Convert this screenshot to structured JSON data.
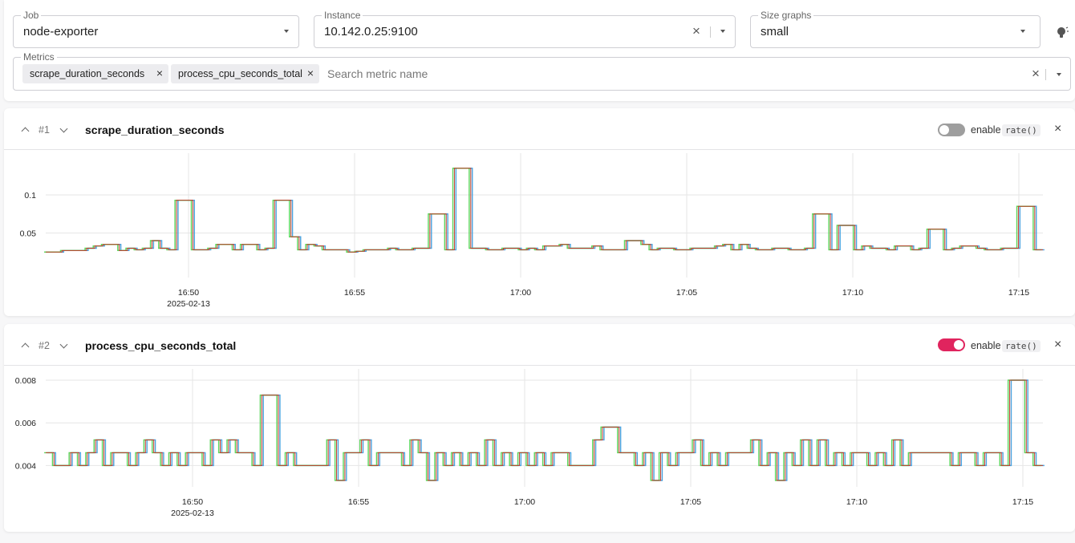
{
  "filters": {
    "job": {
      "label": "Job",
      "value": "node-exporter"
    },
    "instance": {
      "label": "Instance",
      "value": "10.142.0.25:9100"
    },
    "size_graphs": {
      "label": "Size graphs",
      "value": "small"
    },
    "metrics": {
      "label": "Metrics",
      "selected": [
        "scrape_duration_seconds",
        "process_cpu_seconds_total"
      ],
      "placeholder": "Search metric name"
    }
  },
  "panels": [
    {
      "index": "#1",
      "title": "scrape_duration_seconds",
      "rate_enabled": false,
      "enable_label": "enable",
      "rate_code": "rate()",
      "y_ticks": [
        "0.1",
        "0.05"
      ],
      "x_ticks": [
        "16:50",
        "16:55",
        "17:00",
        "17:05",
        "17:10",
        "17:15"
      ],
      "x_date": "2025-02-13"
    },
    {
      "index": "#2",
      "title": "process_cpu_seconds_total",
      "rate_enabled": true,
      "enable_label": "enable",
      "rate_code": "rate()",
      "y_ticks": [
        "0.008",
        "0.006",
        "0.004"
      ],
      "x_ticks": [
        "16:50",
        "16:55",
        "17:00",
        "17:05",
        "17:10",
        "17:15"
      ],
      "x_date": "2025-02-13"
    }
  ],
  "colors": {
    "series": [
      "#4aa3df",
      "#c0392b",
      "#5cd65c"
    ],
    "toggle_on": "#e0245e",
    "toggle_off": "#9e9e9e"
  },
  "chart_data": [
    {
      "type": "line",
      "title": "scrape_duration_seconds",
      "x_range": [
        "16:46",
        "17:16"
      ],
      "ylim": [
        0,
        0.14
      ],
      "series_count": 3,
      "values": [
        0.025,
        0.025,
        0.027,
        0.027,
        0.027,
        0.03,
        0.033,
        0.035,
        0.035,
        0.027,
        0.03,
        0.028,
        0.03,
        0.04,
        0.03,
        0.028,
        0.093,
        0.093,
        0.028,
        0.028,
        0.03,
        0.035,
        0.035,
        0.028,
        0.035,
        0.035,
        0.028,
        0.03,
        0.093,
        0.093,
        0.045,
        0.028,
        0.035,
        0.033,
        0.028,
        0.028,
        0.028,
        0.025,
        0.026,
        0.028,
        0.028,
        0.028,
        0.03,
        0.028,
        0.028,
        0.03,
        0.03,
        0.075,
        0.075,
        0.028,
        0.135,
        0.135,
        0.03,
        0.03,
        0.028,
        0.028,
        0.03,
        0.03,
        0.028,
        0.03,
        0.028,
        0.033,
        0.033,
        0.035,
        0.03,
        0.03,
        0.03,
        0.033,
        0.028,
        0.028,
        0.028,
        0.04,
        0.04,
        0.035,
        0.028,
        0.03,
        0.03,
        0.028,
        0.028,
        0.03,
        0.03,
        0.03,
        0.033,
        0.035,
        0.028,
        0.035,
        0.03,
        0.028,
        0.028,
        0.03,
        0.03,
        0.028,
        0.028,
        0.03,
        0.075,
        0.075,
        0.028,
        0.06,
        0.06,
        0.028,
        0.033,
        0.03,
        0.03,
        0.028,
        0.033,
        0.033,
        0.028,
        0.03,
        0.055,
        0.055,
        0.028,
        0.03,
        0.033,
        0.033,
        0.03,
        0.028,
        0.028,
        0.03,
        0.03,
        0.085,
        0.085,
        0.028,
        0.028
      ]
    },
    {
      "type": "line",
      "title": "process_cpu_seconds_total",
      "x_range": [
        "16:46",
        "17:16"
      ],
      "ylim": [
        0.0033,
        0.008
      ],
      "series_count": 3,
      "values": [
        0.0046,
        0.004,
        0.004,
        0.0046,
        0.004,
        0.0046,
        0.0052,
        0.004,
        0.0046,
        0.0046,
        0.004,
        0.0046,
        0.0052,
        0.0046,
        0.004,
        0.0046,
        0.004,
        0.0046,
        0.0046,
        0.004,
        0.0052,
        0.0046,
        0.0052,
        0.0046,
        0.0046,
        0.004,
        0.0073,
        0.0073,
        0.004,
        0.0046,
        0.004,
        0.004,
        0.004,
        0.004,
        0.0052,
        0.0033,
        0.0046,
        0.0046,
        0.0052,
        0.004,
        0.0046,
        0.0046,
        0.0046,
        0.004,
        0.0052,
        0.0046,
        0.0033,
        0.0046,
        0.004,
        0.0046,
        0.004,
        0.0046,
        0.004,
        0.0052,
        0.004,
        0.0046,
        0.004,
        0.0046,
        0.004,
        0.0046,
        0.004,
        0.0046,
        0.0046,
        0.004,
        0.004,
        0.004,
        0.0052,
        0.0058,
        0.0058,
        0.0046,
        0.0046,
        0.004,
        0.0046,
        0.0033,
        0.0046,
        0.004,
        0.0046,
        0.0046,
        0.0052,
        0.004,
        0.0046,
        0.004,
        0.0046,
        0.0046,
        0.0046,
        0.0052,
        0.004,
        0.0046,
        0.0033,
        0.0046,
        0.004,
        0.0052,
        0.004,
        0.0052,
        0.004,
        0.0046,
        0.004,
        0.0046,
        0.0046,
        0.004,
        0.0046,
        0.004,
        0.0052,
        0.004,
        0.0046,
        0.0046,
        0.0046,
        0.0046,
        0.0046,
        0.004,
        0.0046,
        0.0046,
        0.004,
        0.0046,
        0.0046,
        0.004,
        0.008,
        0.008,
        0.0046,
        0.004,
        0.004
      ]
    }
  ]
}
